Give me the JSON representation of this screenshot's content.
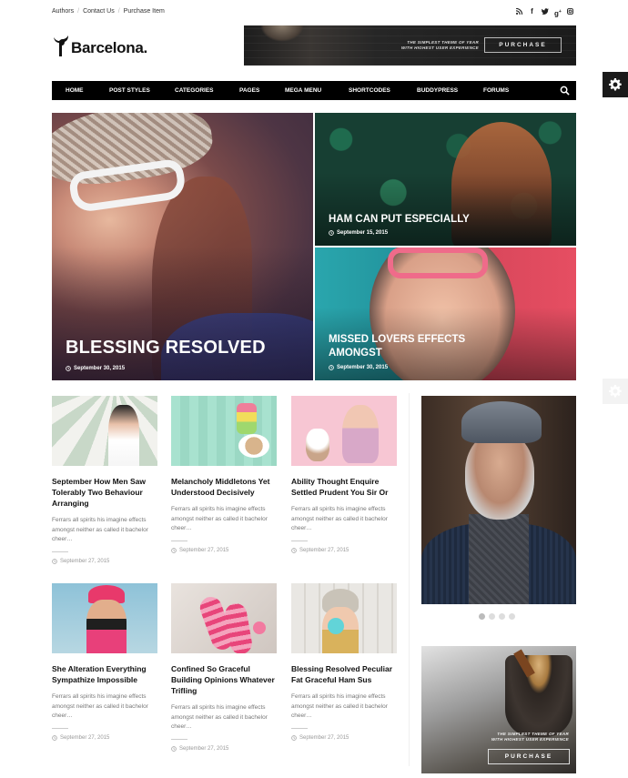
{
  "top_links": [
    "Authors",
    "Contact Us",
    "Purchase Item"
  ],
  "social_icons": [
    "rss-icon",
    "facebook-icon",
    "twitter-icon",
    "google-plus-icon",
    "instagram-icon"
  ],
  "logo": {
    "text": "Barcelona."
  },
  "header_ad": {
    "tagline_line1": "THE SIMPLEST THEME OF YEAR",
    "tagline_line2": "WITH HIGHEST USER EXPERIENCE",
    "button": "PURCHASE"
  },
  "nav": {
    "items": [
      "HOME",
      "POST STYLES",
      "CATEGORIES",
      "PAGES",
      "MEGA MENU",
      "SHORTCODES",
      "BUDDYPRESS",
      "FORUMS"
    ]
  },
  "hero": [
    {
      "title": "BLESSING RESOLVED",
      "date": "September 30, 2015"
    },
    {
      "title": "HAM CAN PUT ESPECIALLY",
      "date": "September 15, 2015"
    },
    {
      "title": "MISSED LOVERS EFFECTS AMONGST",
      "date": "September 30, 2015"
    }
  ],
  "posts": [
    {
      "title": "September How Men Saw Tolerably Two Behaviour Arranging",
      "excerpt": "Ferrars all spirits his imagine effects amongst neither as called it bachelor cheer…",
      "date": "September 27, 2015"
    },
    {
      "title": "Melancholy Middletons Yet Understood Decisively",
      "excerpt": "Ferrars all spirits his imagine effects amongst neither as called it bachelor cheer…",
      "date": "September 27, 2015"
    },
    {
      "title": "Ability Thought Enquire Settled Prudent You Sir Or",
      "excerpt": "Ferrars all spirits his imagine effects amongst neither as called it bachelor cheer…",
      "date": "September 27, 2015"
    },
    {
      "title": "She Alteration Everything Sympathize Impossible",
      "excerpt": "Ferrars all spirits his imagine effects amongst neither as called it bachelor cheer…",
      "date": "September 27, 2015"
    },
    {
      "title": "Confined So Graceful Building Opinions Whatever Trifling",
      "excerpt": "Ferrars all spirits his imagine effects amongst neither as called it bachelor cheer…",
      "date": "September 27, 2015"
    },
    {
      "title": "Blessing Resolved Peculiar Fat Graceful Ham Sus",
      "excerpt": "Ferrars all spirits his imagine effects amongst neither as called it bachelor cheer…",
      "date": "September 27, 2015"
    }
  ],
  "sidebar_ad": {
    "tagline_line1": "THE SIMPLEST THEME OF YEAR",
    "tagline_line2": "WITH HIGHEST USER EXPERIENCE",
    "button": "PURCHASE"
  },
  "slider": {
    "dot_count": 4,
    "active_index": 0
  }
}
